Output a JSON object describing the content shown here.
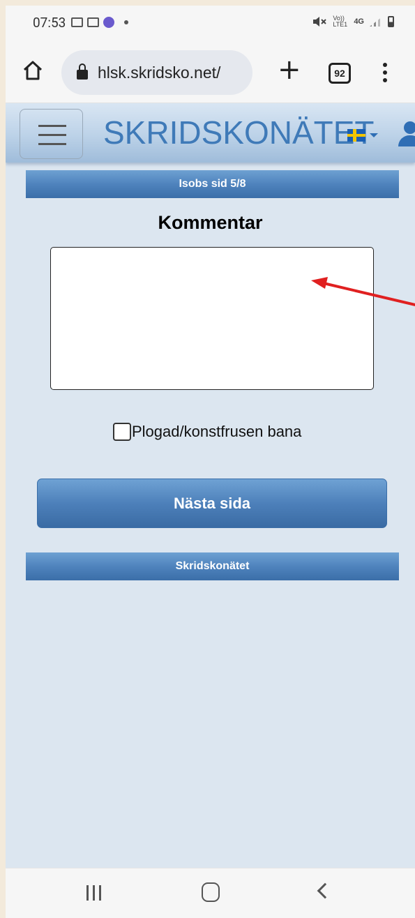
{
  "status_bar": {
    "time": "07:53",
    "network": "4G",
    "network_sub": "Vo)) LTE1"
  },
  "browser": {
    "url": "hlsk.skridsko.net/",
    "tab_count": "92"
  },
  "site": {
    "brand": "SKRIDSKONÄTET"
  },
  "page": {
    "step_header": "Isobs sid 5/8",
    "title": "Kommentar",
    "comment_value": "",
    "checkbox_label": "Plogad/konstfrusen bana",
    "checkbox_checked": false,
    "next_button": "Nästa sida",
    "footer": "Skridskonätet"
  },
  "colors": {
    "page_bg": "#dce6f0",
    "bar_blue": "#4f83bd",
    "brand_blue": "#3f7ab8",
    "annotation_arrow": "#e02020"
  }
}
